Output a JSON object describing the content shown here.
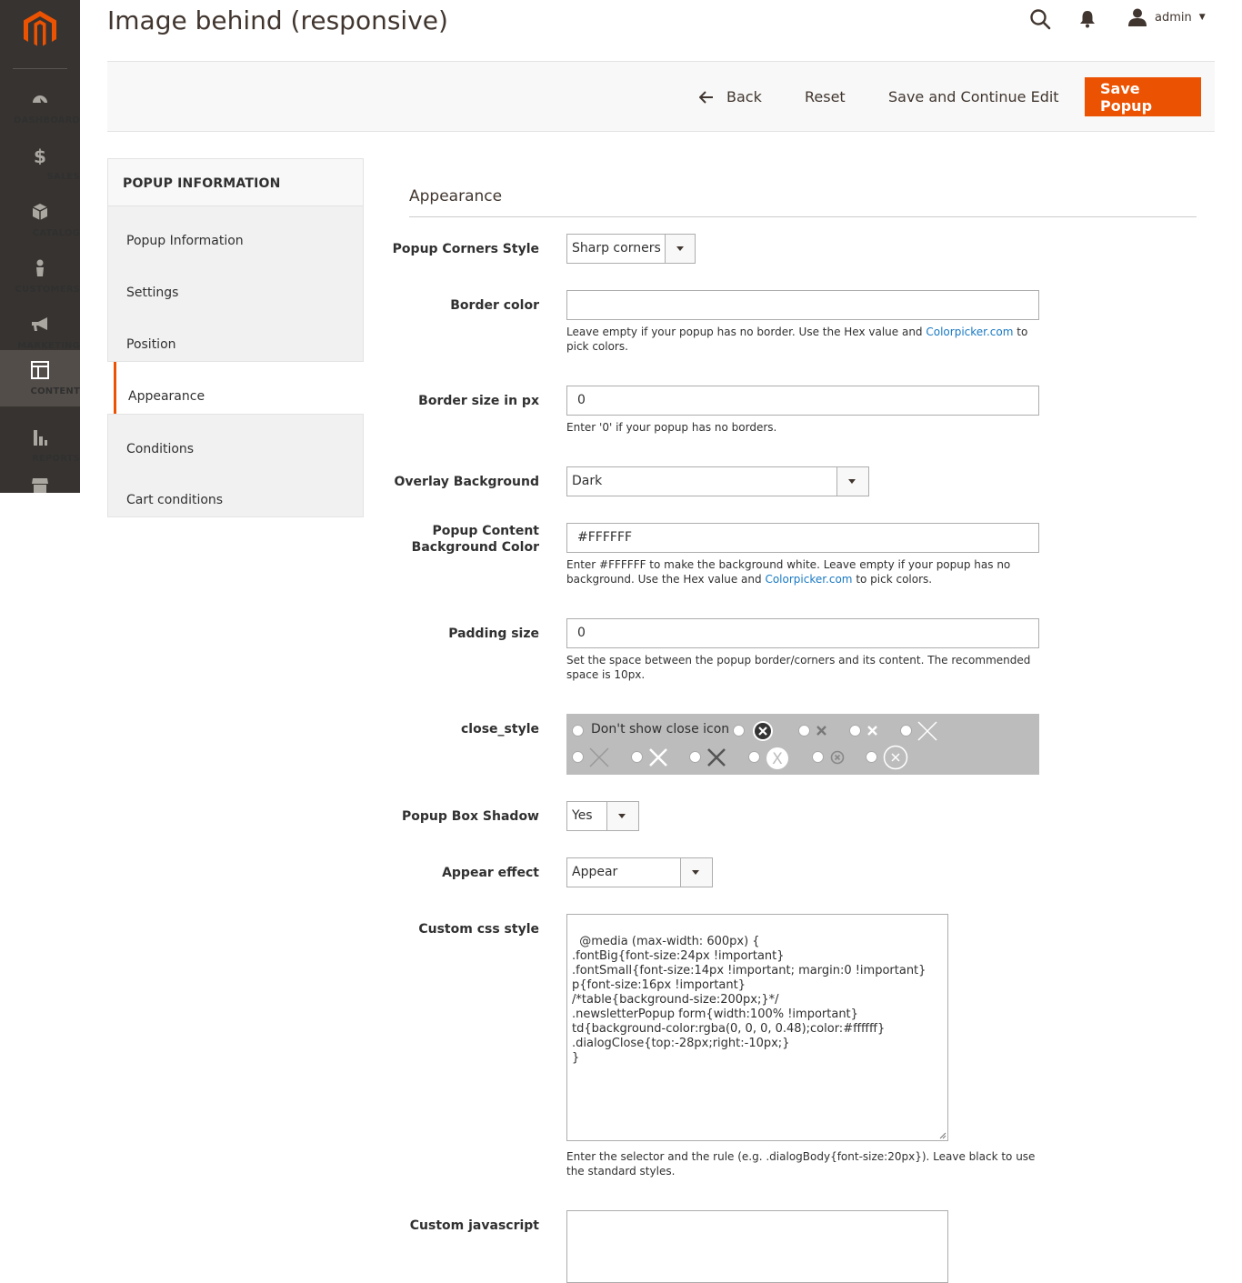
{
  "sidebar": {
    "items": [
      {
        "label": "DASHBOARD",
        "icon": "speedometer-icon"
      },
      {
        "label": "SALES",
        "icon": "dollar-icon"
      },
      {
        "label": "CATALOG",
        "icon": "box-icon"
      },
      {
        "label": "CUSTOMERS",
        "icon": "person-icon"
      },
      {
        "label": "MARKETING",
        "icon": "megaphone-icon"
      },
      {
        "label": "CONTENT",
        "icon": "layout-icon",
        "active": true
      },
      {
        "label": "REPORTS",
        "icon": "bar-chart-icon"
      }
    ]
  },
  "header": {
    "title": "Image behind (responsive)",
    "user": "admin"
  },
  "toolbar": {
    "back_label": "Back",
    "reset_label": "Reset",
    "save_continue_label": "Save and Continue Edit",
    "save_label": "Save Popup"
  },
  "tabs": {
    "heading": "POPUP INFORMATION",
    "items": [
      "Popup Information",
      "Settings",
      "Position",
      "Appearance",
      "Conditions",
      "Cart conditions"
    ],
    "active": "Appearance"
  },
  "form": {
    "section_title": "Appearance",
    "corners": {
      "label": "Popup Corners Style",
      "value": "Sharp corners"
    },
    "border_color": {
      "label": "Border color",
      "value": "",
      "note_before": "Leave empty if your popup has no border. Use the Hex value and ",
      "note_link": "Colorpicker.com",
      "note_after": " to pick colors."
    },
    "border_size": {
      "label": "Border size in px",
      "value": "0",
      "note": "Enter '0' if your popup has no borders."
    },
    "overlay": {
      "label": "Overlay Background",
      "value": "Dark"
    },
    "content_bg": {
      "label": "Popup Content Background Color",
      "value": "#FFFFFF",
      "note_before": "Enter #FFFFFF to make the background white. Leave empty if your popup has no background. Use the Hex value and ",
      "note_link": "Colorpicker.com",
      "note_after": " to pick colors."
    },
    "padding": {
      "label": "Padding size",
      "value": "0",
      "note": "Set the space between the popup border/corners and its content. The recommended space is 10px."
    },
    "close_style": {
      "label": "close_style",
      "none_label": "Don't show close icon"
    },
    "shadow": {
      "label": "Popup Box Shadow",
      "value": "Yes"
    },
    "effect": {
      "label": "Appear effect",
      "value": "Appear"
    },
    "custom_css": {
      "label": "Custom css style",
      "value": "@media (max-width: 600px) {\n.fontBig{font-size:24px !important}\n.fontSmall{font-size:14px !important; margin:0 !important}\np{font-size:16px !important}\n/*table{background-size:200px;}*/\n.newsletterPopup form{width:100% !important}\ntd{background-color:rgba(0, 0, 0, 0.48);color:#ffffff}\n.dialogClose{top:-28px;right:-10px;}\n}",
      "note": "Enter the selector and the rule (e.g. .dialogBody{font-size:20px}). Leave black to use the standard styles."
    },
    "custom_js": {
      "label": "Custom javascript",
      "value": ""
    }
  },
  "colors": {
    "accent": "#eb5202",
    "sidebar": "#373330",
    "link": "#1979c3"
  }
}
